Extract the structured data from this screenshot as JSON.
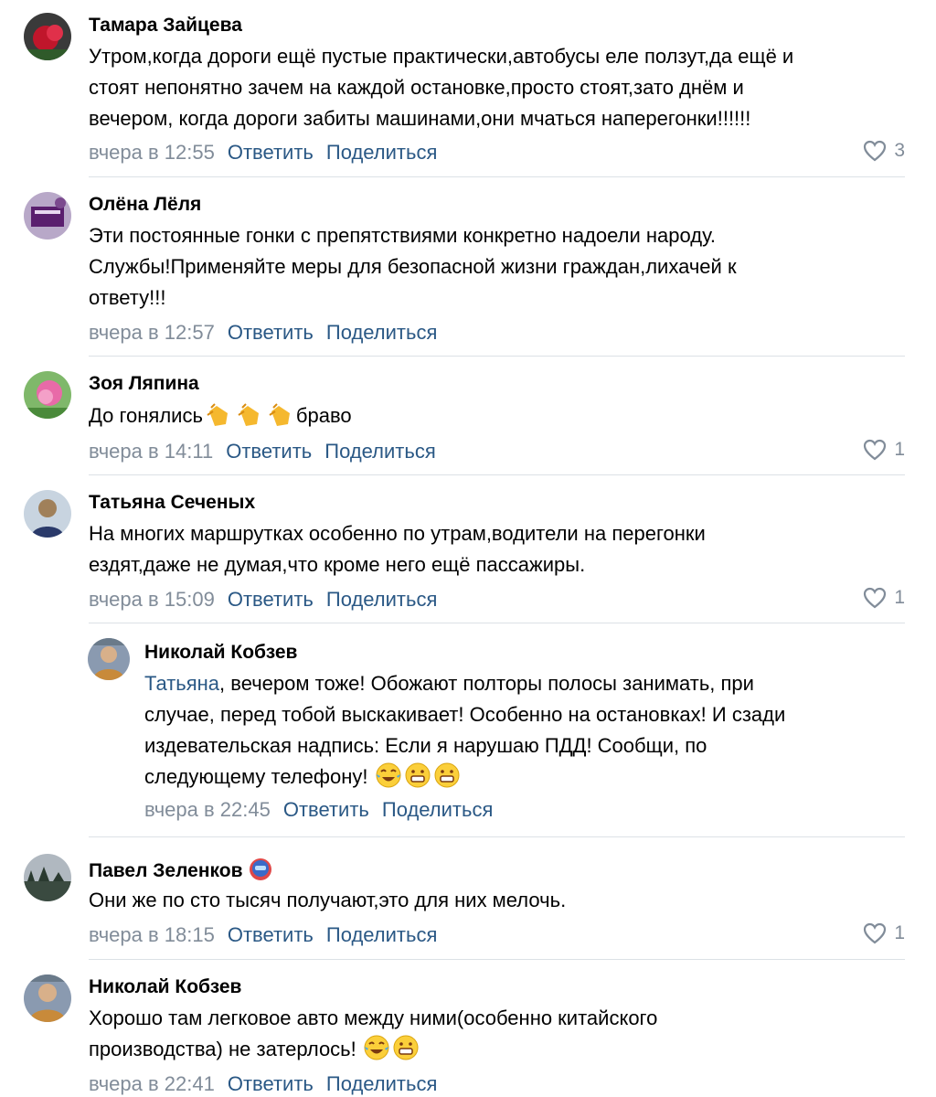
{
  "comments": [
    {
      "author": "Тамара Зайцева",
      "lines": [
        "Утром,когда дороги ещё пустые практически,автобусы еле ползут,да ещё и",
        "стоят непонятно зачем на каждой остановке,просто стоят,зато днём и",
        "вечером, когда дороги забиты машинами,они мчаться наперегонки!!!!!!"
      ],
      "time": "вчера в 12:55",
      "likes": "3"
    },
    {
      "author": "Олёна Лёля",
      "lines": [
        "Эти постоянные гонки с препятствиями конкретно надоели народу.",
        "Службы!Применяйте меры для безопасной жизни граждан,лихачей к",
        "ответу!!!"
      ],
      "time": "вчера в 12:57",
      "likes": ""
    },
    {
      "author": "Зоя Ляпина",
      "text_before": "До гонялись",
      "text_after": "браво",
      "time": "вчера в 14:11",
      "likes": "1"
    },
    {
      "author": "Татьяна Сеченых",
      "lines": [
        "На многих маршрутках особенно по утрам,водители на перегонки",
        "ездят,даже не думая,что кроме него ещё пассажиры."
      ],
      "time": "вчера в 15:09",
      "likes": "1"
    },
    {
      "author": "Николай Кобзев",
      "mention": "Татьяна",
      "first_line_rest": ", вечером тоже! Обожают полторы полосы занимать, при",
      "lines": [
        "случае, перед тобой выскакивает! Особенно на остановках! И сзади",
        "издевательская надпись: Если я нарушаю ПДД! Сообщи, по"
      ],
      "last_line": "следующему телефону!",
      "time": "вчера в 22:45",
      "likes": ""
    },
    {
      "author": "Павел Зеленков",
      "lines": [
        "Они же по сто тысяч получают,это для них мелочь."
      ],
      "time": "вчера в 18:15",
      "likes": "1"
    },
    {
      "author": "Николай Кобзев",
      "lines": [
        "Хорошо там легковое авто между ними(особенно китайского"
      ],
      "last_line": "производства) не затерлось!",
      "time": "вчера в 22:41",
      "likes": ""
    }
  ],
  "actions": {
    "reply": "Ответить",
    "share": "Поделиться"
  },
  "icons": {
    "like": "heart-outline-icon",
    "clap": "clapping-hands-emoji",
    "laugh": "tears-of-joy-emoji",
    "grin": "grinning-face-emoji",
    "badge": "astronaut-badge-icon"
  },
  "colors": {
    "link": "#2a5885",
    "meta": "#818c99",
    "separator": "#dce1e6"
  }
}
